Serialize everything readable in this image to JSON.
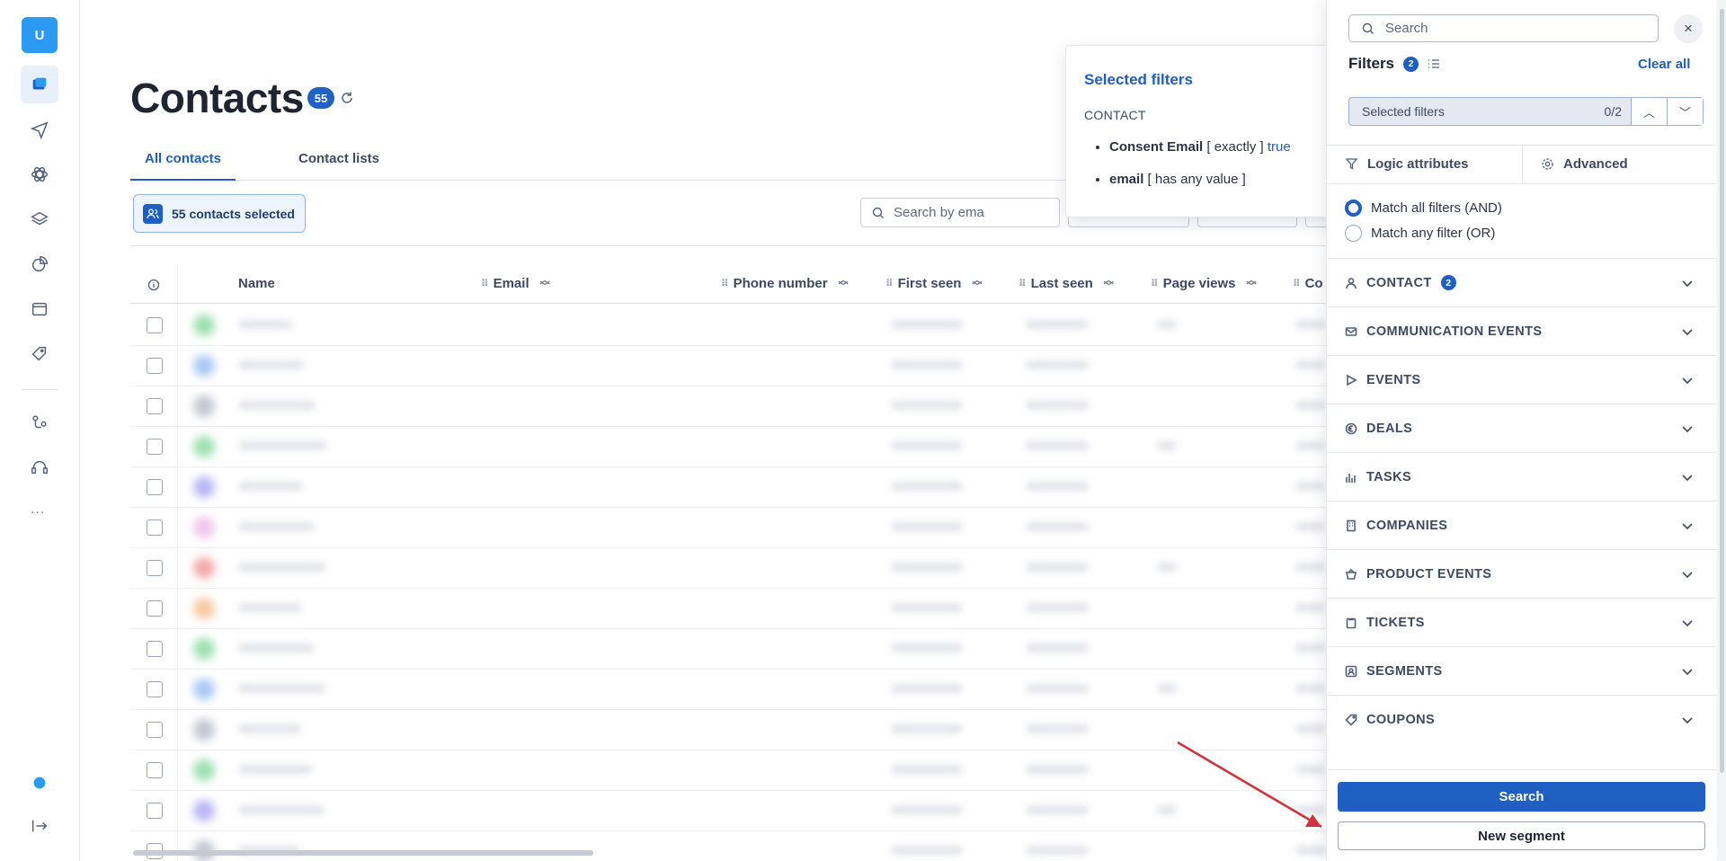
{
  "rail": {
    "avatar": "U",
    "items": [
      "inbox-icon",
      "send-icon",
      "atom-icon",
      "layers-icon",
      "pie-icon",
      "browser-icon",
      "tag-heart-icon",
      "flow-icon",
      "support-icon"
    ],
    "more": "..."
  },
  "header": {
    "title": "Contacts",
    "count": "55"
  },
  "tabs": [
    {
      "label": "All contacts",
      "active": true
    },
    {
      "label": "Contact lists",
      "active": false
    }
  ],
  "toolbar": {
    "selected_label": "55 contacts selected",
    "search_placeholder": "Search by ema"
  },
  "table": {
    "columns": [
      "Name",
      "Email",
      "Phone number",
      "First seen",
      "Last seen",
      "Page views",
      "Co"
    ],
    "row_count": 14
  },
  "popover": {
    "title": "Selected filters",
    "section": "CONTACT",
    "filters": [
      {
        "attr": "Consent Email",
        "op": "[ exactly ]",
        "value": "true"
      },
      {
        "attr": "email",
        "op": "[ has any value ]",
        "value": ""
      }
    ]
  },
  "panel": {
    "search_placeholder": "Search",
    "close": "×",
    "filters_title": "Filters",
    "filters_count": "2",
    "clear_all": "Clear all",
    "selected_filters": "Selected filters",
    "selected_counter": "0/2",
    "logic_label": "Logic attributes",
    "advanced_label": "Advanced",
    "match_all": "Match all filters (AND)",
    "match_any": "Match any filter (OR)",
    "categories": [
      {
        "label": "CONTACT",
        "badge": "2",
        "icon": "person-icon"
      },
      {
        "label": "COMMUNICATION EVENTS",
        "badge": "",
        "icon": "mail-icon"
      },
      {
        "label": "EVENTS",
        "badge": "",
        "icon": "play-icon"
      },
      {
        "label": "DEALS",
        "badge": "",
        "icon": "euro-icon"
      },
      {
        "label": "TASKS",
        "badge": "",
        "icon": "bars-icon"
      },
      {
        "label": "COMPANIES",
        "badge": "",
        "icon": "building-icon"
      },
      {
        "label": "PRODUCT EVENTS",
        "badge": "",
        "icon": "basket-icon"
      },
      {
        "label": "TICKETS",
        "badge": "",
        "icon": "clipboard-icon"
      },
      {
        "label": "SEGMENTS",
        "badge": "",
        "icon": "segment-icon"
      },
      {
        "label": "COUPONS",
        "badge": "",
        "icon": "tag-icon"
      }
    ],
    "search_button": "Search",
    "new_segment_button": "New segment"
  },
  "colors": {
    "accent": "#1e5fc1",
    "avatar": "#2b9af3",
    "annotation_arrow": "#d0343a"
  }
}
